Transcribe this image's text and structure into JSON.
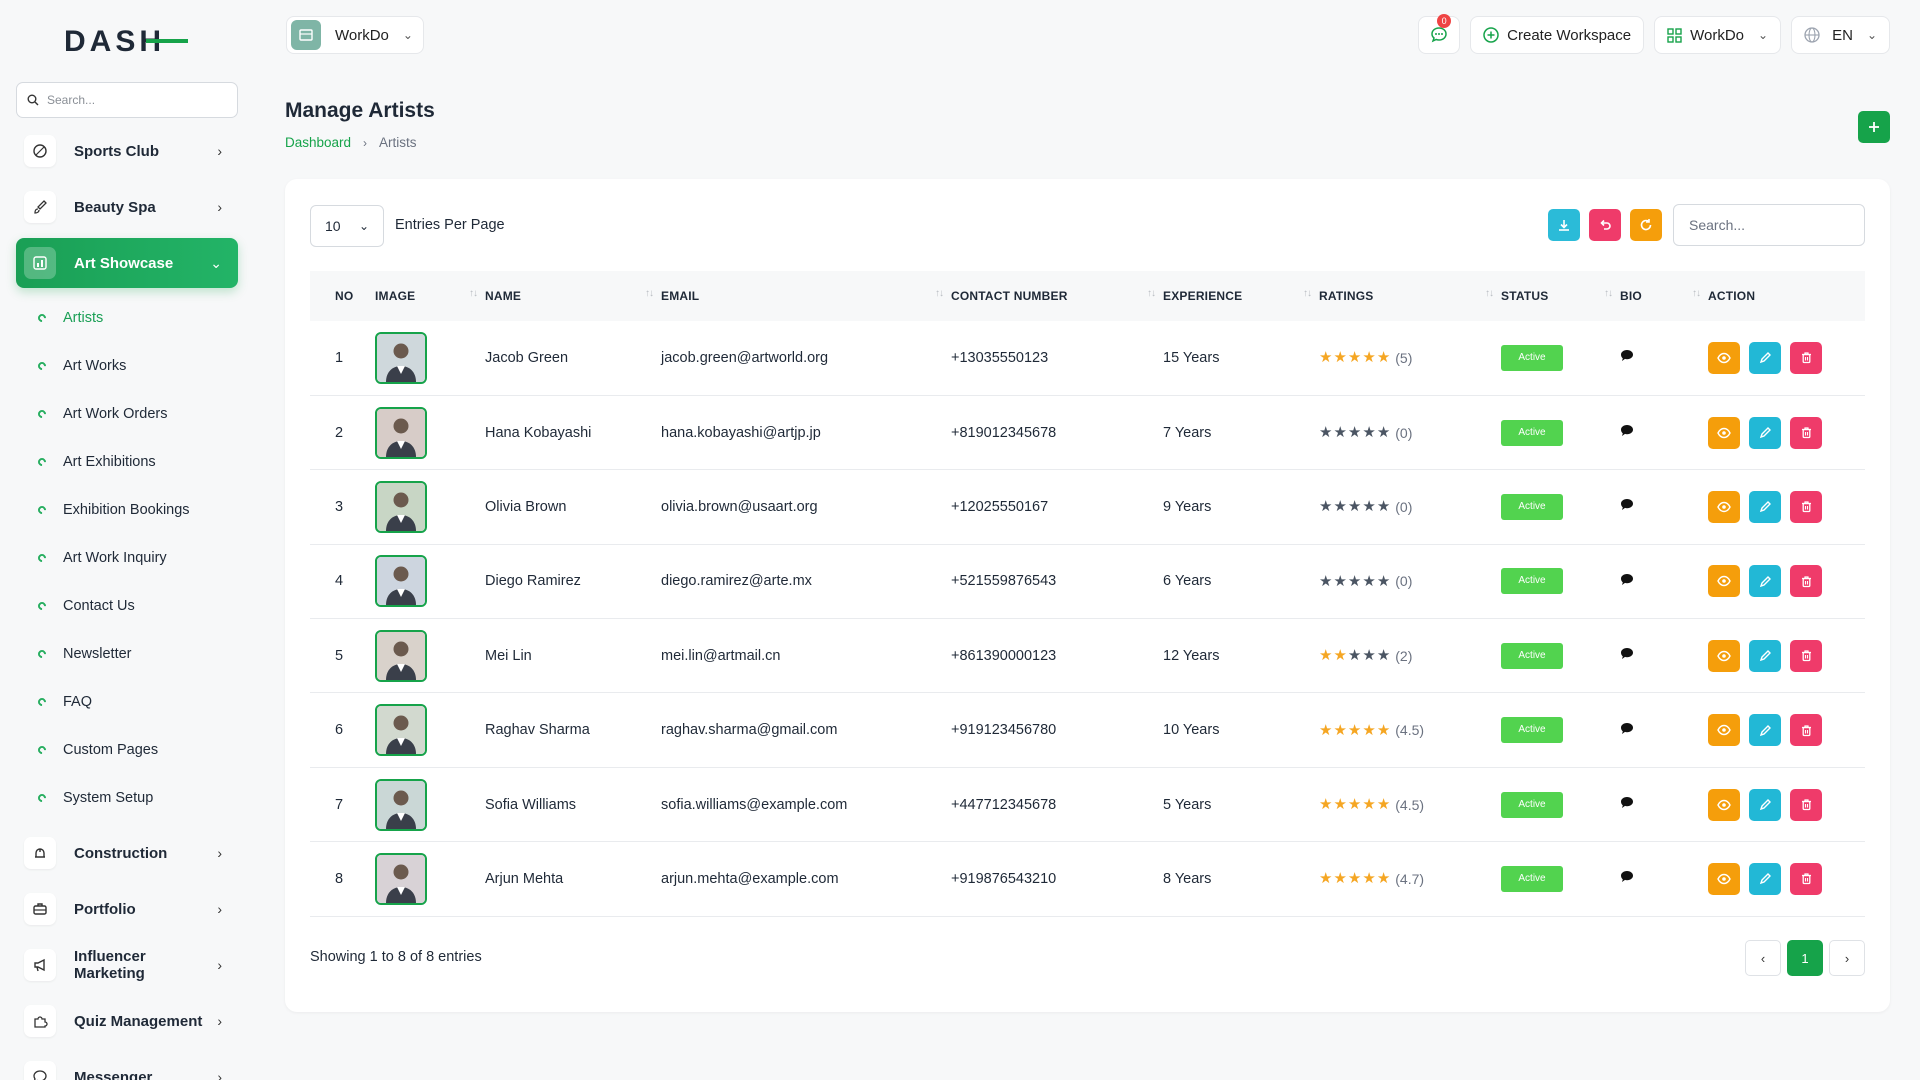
{
  "brand": {
    "logo_text": "DASH",
    "accent": "#16a34a"
  },
  "sidebar": {
    "search_placeholder": "Search...",
    "items_before": [
      {
        "label": "Sports Club",
        "icon": "sports-icon"
      },
      {
        "label": "Beauty Spa",
        "icon": "brush-icon"
      }
    ],
    "active": {
      "label": "Art Showcase",
      "icon": "art-icon"
    },
    "subitems": [
      {
        "label": "Artists",
        "active": true
      },
      {
        "label": "Art Works"
      },
      {
        "label": "Art Work Orders"
      },
      {
        "label": "Art Exhibitions"
      },
      {
        "label": "Exhibition Bookings"
      },
      {
        "label": "Art Work Inquiry"
      },
      {
        "label": "Contact Us"
      },
      {
        "label": "Newsletter"
      },
      {
        "label": "FAQ"
      },
      {
        "label": "Custom Pages"
      },
      {
        "label": "System Setup"
      }
    ],
    "items_after": [
      {
        "label": "Construction",
        "icon": "construction-icon"
      },
      {
        "label": "Portfolio",
        "icon": "briefcase-icon"
      },
      {
        "label": "Influencer Marketing",
        "icon": "megaphone-icon"
      },
      {
        "label": "Quiz Management",
        "icon": "puzzle-icon"
      },
      {
        "label": "Messenger",
        "icon": "chat-icon"
      }
    ]
  },
  "topbar": {
    "workspace": "WorkDo",
    "notifications": "0",
    "create_workspace": "Create Workspace",
    "workspace_switch": "WorkDo",
    "language": "EN"
  },
  "page": {
    "title": "Manage Artists",
    "breadcrumb_home": "Dashboard",
    "breadcrumb_current": "Artists"
  },
  "table_controls": {
    "per_page": "10",
    "per_page_label": "Entries Per Page",
    "search_placeholder": "Search..."
  },
  "table": {
    "headers": [
      "NO",
      "IMAGE",
      "NAME",
      "EMAIL",
      "CONTACT NUMBER",
      "EXPERIENCE",
      "RATINGS",
      "STATUS",
      "BIO",
      "ACTION"
    ],
    "rows": [
      {
        "no": "1",
        "name": "Jacob Green",
        "email": "jacob.green@artworld.org",
        "phone": "+13035550123",
        "experience": "15 Years",
        "rating": 5,
        "rating_label": "(5)",
        "status": "Active"
      },
      {
        "no": "2",
        "name": "Hana Kobayashi",
        "email": "hana.kobayashi@artjp.jp",
        "phone": "+819012345678",
        "experience": "7 Years",
        "rating": 0,
        "rating_label": "(0)",
        "status": "Active"
      },
      {
        "no": "3",
        "name": "Olivia Brown",
        "email": "olivia.brown@usaart.org",
        "phone": "+12025550167",
        "experience": "9 Years",
        "rating": 0,
        "rating_label": "(0)",
        "status": "Active"
      },
      {
        "no": "4",
        "name": "Diego Ramirez",
        "email": "diego.ramirez@arte.mx",
        "phone": "+521559876543",
        "experience": "6 Years",
        "rating": 0,
        "rating_label": "(0)",
        "status": "Active"
      },
      {
        "no": "5",
        "name": "Mei Lin",
        "email": "mei.lin@artmail.cn",
        "phone": "+861390000123",
        "experience": "12 Years",
        "rating": 2,
        "rating_label": "(2)",
        "status": "Active"
      },
      {
        "no": "6",
        "name": "Raghav Sharma",
        "email": "raghav.sharma@gmail.com",
        "phone": "+919123456780",
        "experience": "10 Years",
        "rating": 4.5,
        "rating_label": "(4.5)",
        "status": "Active"
      },
      {
        "no": "7",
        "name": "Sofia Williams",
        "email": "sofia.williams@example.com",
        "phone": "+447712345678",
        "experience": "5 Years",
        "rating": 4.5,
        "rating_label": "(4.5)",
        "status": "Active"
      },
      {
        "no": "8",
        "name": "Arjun Mehta",
        "email": "arjun.mehta@example.com",
        "phone": "+919876543210",
        "experience": "8 Years",
        "rating": 4.7,
        "rating_label": "(4.7)",
        "status": "Active"
      }
    ]
  },
  "footer": {
    "showing": "Showing 1 to 8 of 8 entries",
    "current_page": "1"
  },
  "colors": {
    "green": "#16a34a",
    "status_green": "#52d34f",
    "view_orange": "#f59e0b",
    "edit_cyan": "#22b8d6",
    "delete_pink": "#ef3b6a",
    "export_cyan": "#2bbbd8",
    "reset_pink": "#ef3b6a",
    "refresh_orange": "#f59e0b",
    "star_gold": "#f5a623",
    "star_gray": "#6b7280"
  }
}
